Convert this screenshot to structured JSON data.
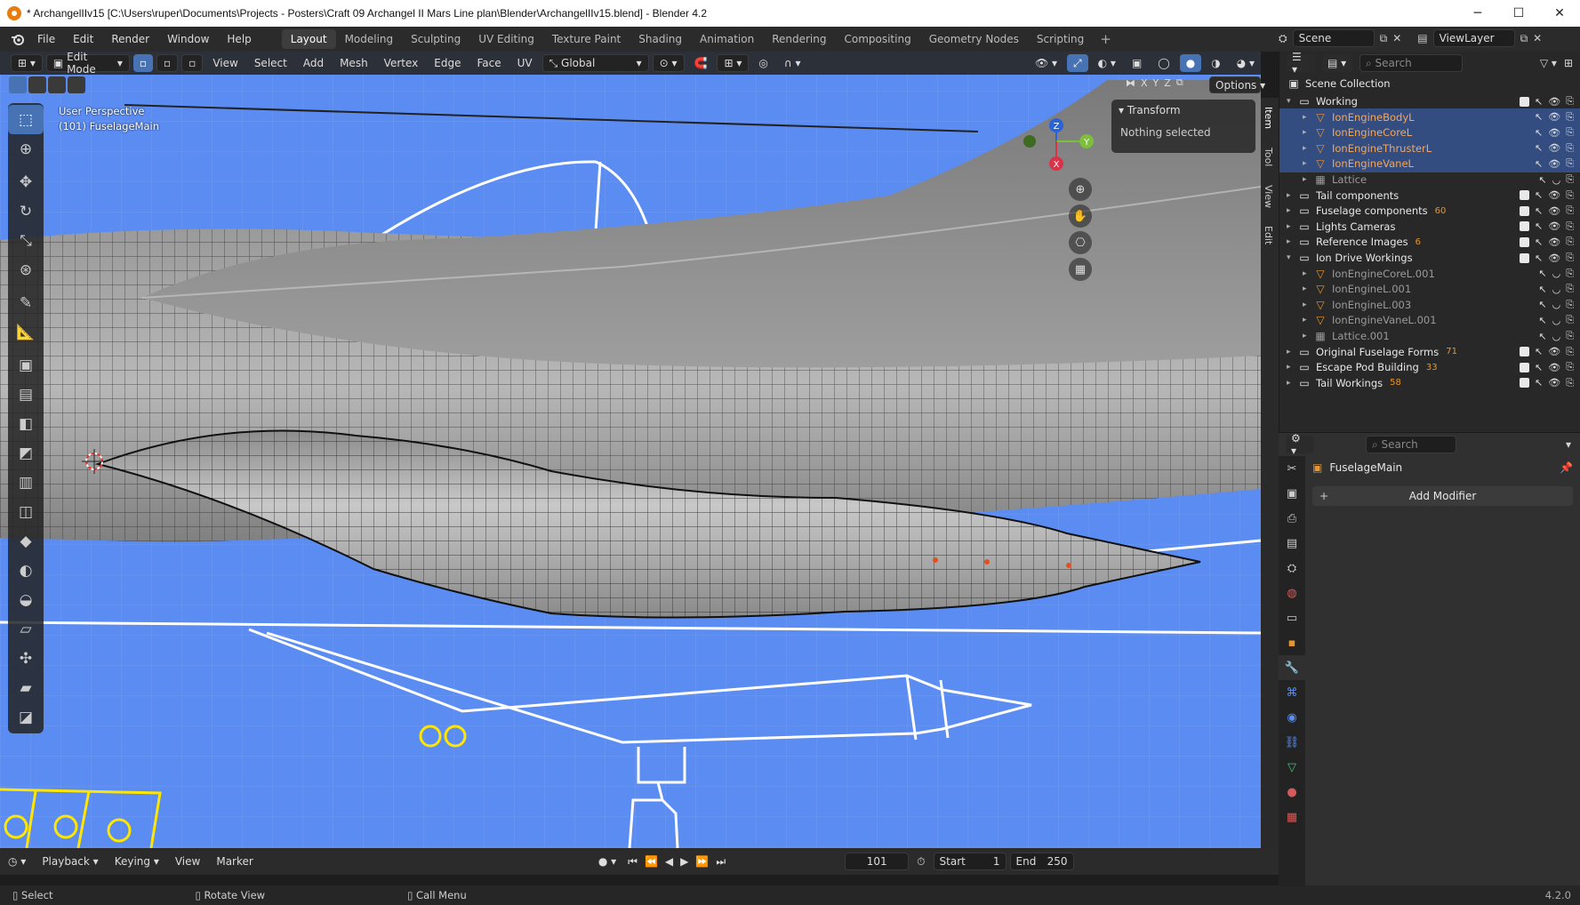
{
  "window": {
    "title": "* ArchangelIIv15 [C:\\Users\\ruper\\Documents\\Projects - Posters\\Craft 09 Archangel II Mars Line plan\\Blender\\ArchangelIIv15.blend] - Blender 4.2",
    "controls": [
      "─",
      "☐",
      "✕"
    ]
  },
  "menubar": {
    "menus": [
      "File",
      "Edit",
      "Render",
      "Window",
      "Help"
    ],
    "workspaces": [
      "Layout",
      "Modeling",
      "Sculpting",
      "UV Editing",
      "Texture Paint",
      "Shading",
      "Animation",
      "Rendering",
      "Compositing",
      "Geometry Nodes",
      "Scripting"
    ],
    "active_workspace": "Layout",
    "scene": "Scene",
    "view_layer": "ViewLayer"
  },
  "viewport_header": {
    "mode": "Edit Mode",
    "menus": [
      "View",
      "Select",
      "Add",
      "Mesh",
      "Vertex",
      "Edge",
      "Face",
      "UV"
    ],
    "orientation": "Global",
    "axes": [
      "X",
      "Y",
      "Z"
    ],
    "options": "Options"
  },
  "viewport": {
    "perspective": "User Perspective",
    "object": "(101) FuselageMain",
    "background_color": "#5a8cf2",
    "gizmo_axes": [
      "Z",
      "Y",
      "X"
    ]
  },
  "transform_panel": {
    "title": "Transform",
    "content": "Nothing selected"
  },
  "npanel_tabs": [
    "Item",
    "Tool",
    "View",
    "Edit"
  ],
  "outliner": {
    "root": "Scene Collection",
    "search_placeholder": "Search",
    "rows": [
      {
        "name": "Working",
        "type": "collection",
        "indent": 0,
        "expanded": true
      },
      {
        "name": "IonEngineBodyL",
        "type": "mesh",
        "indent": 1,
        "selected": true,
        "orange": true
      },
      {
        "name": "IonEngineCoreL",
        "type": "mesh",
        "indent": 1,
        "selected": true,
        "orange": true
      },
      {
        "name": "IonEngineThrusterL",
        "type": "mesh",
        "indent": 1,
        "selected": true,
        "orange": true
      },
      {
        "name": "IonEngineVaneL",
        "type": "mesh",
        "indent": 1,
        "selected": true,
        "orange": true
      },
      {
        "name": "Lattice",
        "type": "lattice",
        "indent": 1,
        "dim": true
      },
      {
        "name": "Tail components",
        "type": "collection",
        "indent": 0
      },
      {
        "name": "Fuselage components",
        "type": "collection",
        "indent": 0,
        "badge": "60"
      },
      {
        "name": "Lights Cameras",
        "type": "collection",
        "indent": 0
      },
      {
        "name": "Reference Images",
        "type": "collection",
        "indent": 0,
        "badge": "6"
      },
      {
        "name": "Ion Drive Workings",
        "type": "collection",
        "indent": 0,
        "expanded": true
      },
      {
        "name": "IonEngineCoreL.001",
        "type": "mesh",
        "indent": 1,
        "dim": true
      },
      {
        "name": "IonEngineL.001",
        "type": "mesh",
        "indent": 1,
        "dim": true
      },
      {
        "name": "IonEngineL.003",
        "type": "mesh",
        "indent": 1,
        "dim": true
      },
      {
        "name": "IonEngineVaneL.001",
        "type": "mesh",
        "indent": 1,
        "dim": true
      },
      {
        "name": "Lattice.001",
        "type": "lattice",
        "indent": 1,
        "dim": true
      },
      {
        "name": "Original Fuselage Forms",
        "type": "collection",
        "indent": 0,
        "badge": "71"
      },
      {
        "name": "Escape Pod Building",
        "type": "collection",
        "indent": 0,
        "badge": "33"
      },
      {
        "name": "Tail Workings",
        "type": "collection",
        "indent": 0,
        "badge": "58"
      }
    ]
  },
  "properties": {
    "search_placeholder": "Search",
    "object_name": "FuselageMain",
    "add_modifier": "Add Modifier"
  },
  "timeline": {
    "menus": [
      "Playback",
      "Keying",
      "View",
      "Marker"
    ],
    "current_frame": "101",
    "start_label": "Start",
    "start": "1",
    "end_label": "End",
    "end": "250"
  },
  "statusbar": {
    "items": [
      "Select",
      "Rotate View",
      "Call Menu"
    ],
    "version": "4.2.0"
  },
  "colors": {
    "accent": "#4772b3",
    "selected_row": "#334d80",
    "orange_text": "#f4a65a",
    "blueprint": "#5a8cf2"
  }
}
